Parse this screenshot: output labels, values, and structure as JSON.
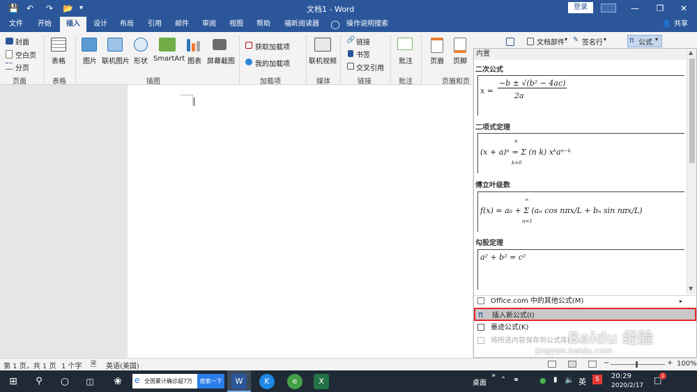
{
  "title_bar": {
    "document_title": "文档1 - Word",
    "login_label": "登录",
    "qat_items": [
      "save-icon",
      "undo-icon",
      "redo-icon",
      "open-icon",
      "customize-icon"
    ]
  },
  "tabs": [
    "文件",
    "开始",
    "插入",
    "设计",
    "布局",
    "引用",
    "邮件",
    "审阅",
    "视图",
    "帮助",
    "福昕阅读器"
  ],
  "active_tab": "插入",
  "tell_me": "操作说明搜索",
  "share": "共享",
  "ribbon": {
    "pages": {
      "cover": "封面",
      "blank": "空白页",
      "page_break": "分页",
      "group": "页面"
    },
    "tables": {
      "table": "表格",
      "group": "表格"
    },
    "illustrations": {
      "picture": "图片",
      "online_picture": "联机图片",
      "shapes": "形状",
      "smartart": "SmartArt",
      "chart": "图表",
      "screenshot": "屏幕截图",
      "group": "插图"
    },
    "addins": {
      "get": "获取加载项",
      "mine": "我的加载项",
      "group": "加载项"
    },
    "media": {
      "online_video": "联机视频",
      "group": "媒体"
    },
    "links": {
      "link": "链接",
      "bookmark": "书签",
      "cross_ref": "交叉引用",
      "group": "链接"
    },
    "comments": {
      "comment": "批注",
      "group": "批注"
    },
    "header_footer": {
      "header": "页眉",
      "footer": "页脚",
      "group": "页眉和页脚"
    },
    "text": {
      "doc_parts": "文档部件",
      "signature": "签名行"
    },
    "symbols": {
      "equation": "公式"
    }
  },
  "equation_panel": {
    "header": "内置",
    "sections": [
      {
        "title": "二次公式",
        "formula_a": "x =",
        "formula_b": "−b ± √(b² − 4ac)",
        "formula_c": "2a"
      },
      {
        "title": "二项式定理",
        "formula": "(x + a)ⁿ = Σ (n k) xᵏaⁿ⁻ᵏ",
        "lower": "k=0",
        "upper": "n"
      },
      {
        "title": "傅立叶级数",
        "formula": "f(x) = a₀ + Σ (aₙ cos nπx/L + bₙ sin nπx/L)",
        "lower": "n=1",
        "upper": "∞"
      },
      {
        "title": "勾股定理",
        "formula": "a² + b² = c²"
      }
    ],
    "menu": {
      "more_office": "Office.com 中的其他公式(M)",
      "insert_new": "插入新公式(I)",
      "ink": "墨迹公式(K)",
      "save_selection": "将所选内容保存到公式库(S)..."
    }
  },
  "status_bar": {
    "page": "第 1 页，共 1 页",
    "words": "1 个字",
    "language": "英语(美国)",
    "zoom": "100%"
  },
  "taskbar": {
    "news": "全国累计确诊超7万",
    "search_btn": "搜索一下",
    "desktop": "桌面",
    "ime": "英",
    "time": "20:29",
    "date": "2020/2/17",
    "notif_count": "1"
  },
  "watermark": {
    "text": "Baidu 经验",
    "url": "jingyan.baidu.com"
  },
  "colors": {
    "accent": "#2b579a",
    "highlight_border": "#e8232a",
    "ribbon_bg": "#f3f3f3"
  }
}
